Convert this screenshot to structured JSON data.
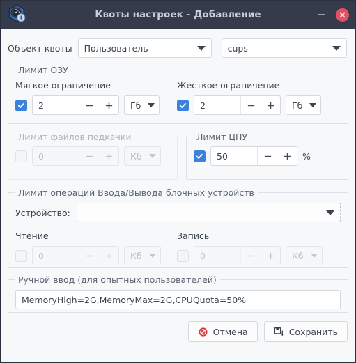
{
  "window": {
    "title": "Квоты настроек - Добавление",
    "icon": "speedometer-quota-icon",
    "minimize_label": "−",
    "close_label": "✕",
    "titlebar_color": "#353b4b",
    "accent_color": "#3b82dd",
    "close_color": "#e05263"
  },
  "quota_object": {
    "label": "Объект квоты",
    "type_select": {
      "value": "Пользователь",
      "placeholder": "Пользователь"
    },
    "name_select": {
      "value": "cups",
      "placeholder": "cups"
    }
  },
  "ram_limit": {
    "legend": "Лимит ОЗУ",
    "soft": {
      "label": "Мягкое ограничение",
      "enabled": true,
      "value": "2",
      "unit": "Гб",
      "minus": "−",
      "plus": "+"
    },
    "hard": {
      "label": "Жесткое ограничение",
      "enabled": true,
      "value": "2",
      "unit": "Гб",
      "minus": "−",
      "plus": "+"
    }
  },
  "swap_limit": {
    "legend": "Лимит файлов подкачки",
    "enabled": false,
    "value": "0",
    "unit": "Кб",
    "minus": "−",
    "plus": "+"
  },
  "cpu_limit": {
    "legend": "Лимит ЦПУ",
    "enabled": true,
    "value": "50",
    "unit": "%",
    "minus": "−",
    "plus": "+"
  },
  "io_limit": {
    "legend": "Лимит операций Ввода/Вывода блочных устройств",
    "device_label": "Устройство:",
    "device_value": "",
    "read": {
      "label": "Чтение",
      "enabled": false,
      "value": "0",
      "unit": "Кб",
      "minus": "−",
      "plus": "+"
    },
    "write": {
      "label": "Запись",
      "enabled": false,
      "value": "0",
      "unit": "Кб",
      "minus": "−",
      "plus": "+"
    }
  },
  "manual": {
    "legend": "Ручной ввод (для опытных пользователей)",
    "value": "MemoryHigh=2G,MemoryMax=2G,CPUQuota=50%"
  },
  "footer": {
    "cancel_label": "Отмена",
    "cancel_icon": "cancel-circle-icon",
    "save_label": "Сохранить",
    "save_icon": "save-disk-icon"
  }
}
